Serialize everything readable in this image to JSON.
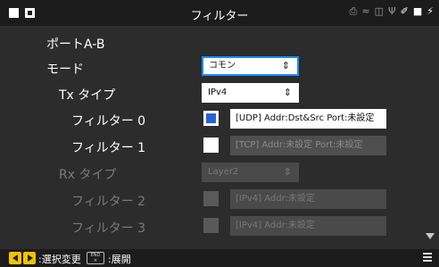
{
  "header": {
    "title": "フィルター",
    "status_icons": [
      "printer-icon",
      "wifi-icon",
      "lan-icon",
      "usb-icon",
      "edit-icon",
      "save-icon",
      "power-icon"
    ]
  },
  "form": {
    "port_label": "ポートA-B",
    "mode": {
      "label": "モード",
      "value": "コモン"
    },
    "tx_type": {
      "label": "Tx タイプ",
      "value": "IPv4"
    },
    "filters_tx": [
      {
        "label": "フィルター 0",
        "checked": true,
        "value": "[UDP] Addr:Dst&Src  Port:未設定"
      },
      {
        "label": "フィルター 1",
        "checked": false,
        "value": "[TCP] Addr:未設定  Port:未設定"
      }
    ],
    "rx_type": {
      "label": "Rx タイプ",
      "value": "Layer2"
    },
    "filters_rx": [
      {
        "label": "フィルター 2",
        "checked": false,
        "value": "[IPv4] Addr:未設定"
      },
      {
        "label": "フィルター 3",
        "checked": false,
        "value": "[IPv4] Addr:未設定"
      }
    ]
  },
  "footer": {
    "change_hint": ":選択変更",
    "end_key": {
      "top": "END",
      "bottom": "×"
    },
    "expand_hint": ":展開"
  },
  "colors": {
    "accent": "#1a8cff",
    "check": "#2563d9",
    "key": "#f1c200"
  }
}
